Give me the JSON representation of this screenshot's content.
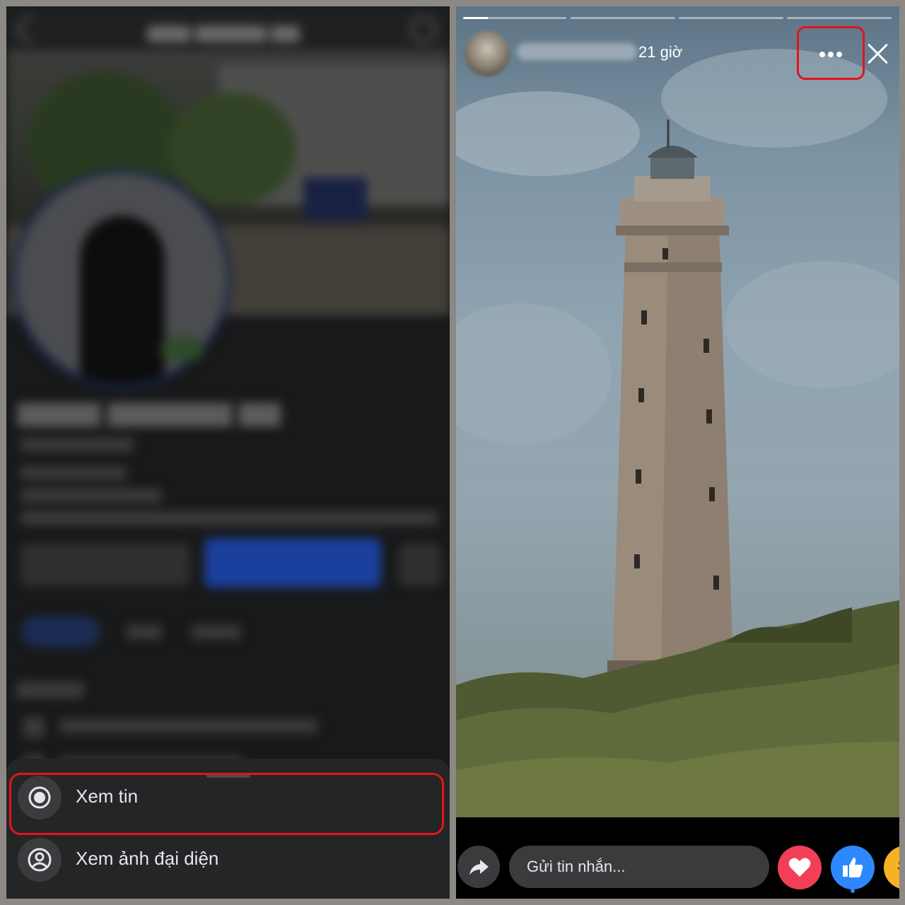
{
  "left_panel": {
    "menu": {
      "items": [
        {
          "label": "Xem tin",
          "icon": "radio-dot-icon",
          "highlighted": true
        },
        {
          "label": "Xem ảnh đại diện",
          "icon": "person-circle-icon",
          "highlighted": false
        }
      ]
    }
  },
  "right_panel": {
    "story": {
      "time": "21 giờ",
      "progress_segments": 4,
      "active_segment": 1
    },
    "reply_input": {
      "placeholder": "Gửi tin nhắn..."
    },
    "reactions": [
      "love-icon",
      "like-icon",
      "haha-icon"
    ],
    "highlight_color": "#e3141b",
    "accent_color": "#2d88ff"
  }
}
